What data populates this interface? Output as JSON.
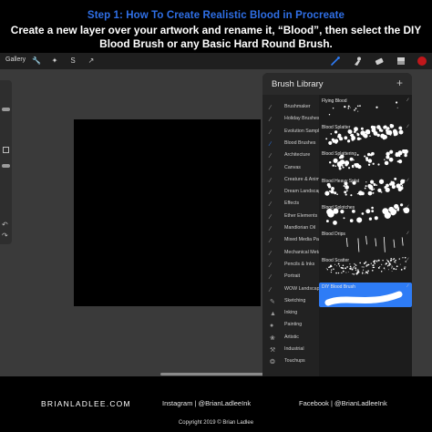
{
  "header": {
    "step_title": "Step 1:  How To Create Realistic Blood in Procreate",
    "instructions": "Create a new layer over your artwork and rename it, “Blood”, then select the DIY Blood Brush or any Basic Hard Round Brush."
  },
  "toolbar": {
    "gallery": "Gallery",
    "left_icons": [
      "wrench-icon",
      "magic-wand-icon",
      "selection-icon",
      "transform-arrow-icon"
    ],
    "right_icons": [
      "brush-icon",
      "smudge-icon",
      "eraser-icon",
      "layers-icon",
      "color-swatch-icon"
    ],
    "active_color": "#2e7cf6",
    "swatch_color": "#c0171b"
  },
  "brush_library": {
    "title": "Brush Library",
    "add_symbol": "+",
    "categories": [
      {
        "label": "Brushmaker",
        "icon": "brush-stroke-icon"
      },
      {
        "label": "Holiday Brushes",
        "icon": "brush-stroke-icon"
      },
      {
        "label": "Evolution Sample",
        "icon": "brush-stroke-icon"
      },
      {
        "label": "Blood Brushes",
        "icon": "brush-stroke-icon",
        "active": true
      },
      {
        "label": "Architecture",
        "icon": "brush-stroke-icon"
      },
      {
        "label": "Canvas",
        "icon": "brush-stroke-icon"
      },
      {
        "label": "Creature & Animal",
        "icon": "brush-stroke-icon"
      },
      {
        "label": "Dream Landscape",
        "icon": "brush-stroke-icon"
      },
      {
        "label": "Effects",
        "icon": "brush-stroke-icon"
      },
      {
        "label": "Ether Elements",
        "icon": "brush-stroke-icon"
      },
      {
        "label": "Mandlorian Oil",
        "icon": "brush-stroke-icon"
      },
      {
        "label": "Mixed Media Paint",
        "icon": "brush-stroke-icon"
      },
      {
        "label": "Mechanical Metal",
        "icon": "brush-stroke-icon"
      },
      {
        "label": "Pencils & Inks",
        "icon": "brush-stroke-icon"
      },
      {
        "label": "Portrait",
        "icon": "brush-stroke-icon"
      },
      {
        "label": "WOW Landscape",
        "icon": "brush-stroke-icon"
      },
      {
        "label": "Sketching",
        "icon": "pencil-icon"
      },
      {
        "label": "Inking",
        "icon": "ink-drop-icon"
      },
      {
        "label": "Painting",
        "icon": "paint-drop-icon"
      },
      {
        "label": "Artistic",
        "icon": "artistic-brush-icon"
      },
      {
        "label": "Industrial",
        "icon": "anvil-icon"
      },
      {
        "label": "Touchups",
        "icon": "touchup-icon"
      }
    ],
    "brushes": [
      {
        "name": "Flying Blood",
        "stroke": "drops"
      },
      {
        "name": "Blood Splatter",
        "stroke": "splatter"
      },
      {
        "name": "Blood Splattering",
        "stroke": "heavy-dots"
      },
      {
        "name": "Blood Heavy Splat",
        "stroke": "heavy-dots"
      },
      {
        "name": "Blood Splotches",
        "stroke": "splotches"
      },
      {
        "name": "Blood Drips",
        "stroke": "drips"
      },
      {
        "name": "Blood Scatter",
        "stroke": "scatter"
      },
      {
        "name": "DIY Blood Brush",
        "stroke": "smooth",
        "active": true
      }
    ]
  },
  "footer": {
    "site": "BRIANLADLEE.COM",
    "instagram": "Instagram  |  @BrianLadleeInk",
    "facebook": "Facebook  |  @BrianLadleeInk",
    "copyright": "Copyright 2019 © Brian Ladlee"
  }
}
